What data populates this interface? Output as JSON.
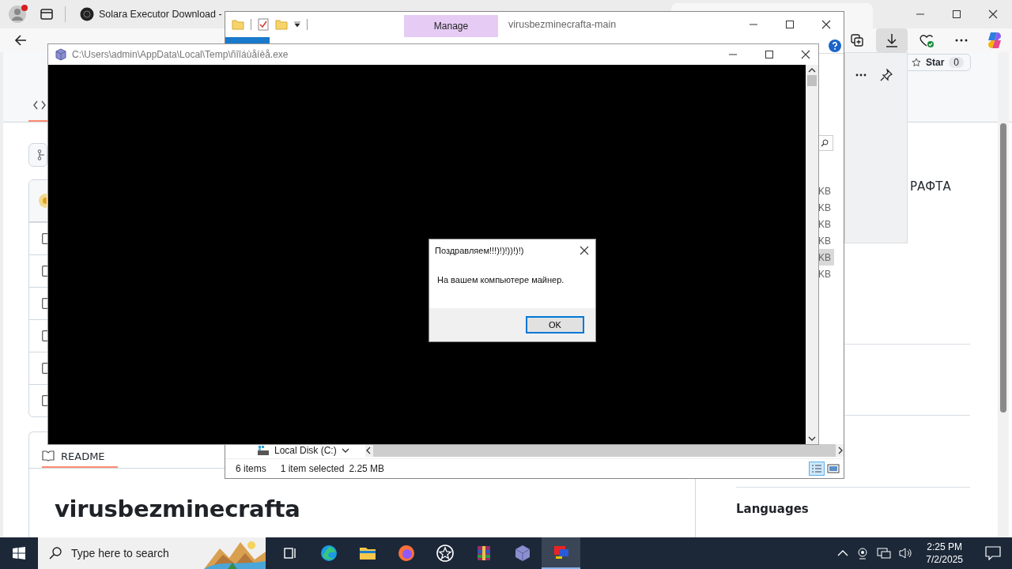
{
  "browser": {
    "tabs": [
      {
        "label": "Solara Executor Download -",
        "selected": false
      }
    ],
    "page": {
      "star_label": "Star",
      "star_count": "0",
      "readme_tab": "README",
      "repo_heading": "virusbezminecrafta",
      "description_fragment": "РАФТА",
      "languages_heading": "Languages"
    }
  },
  "explorer": {
    "title": "virusbezminecrafta-main",
    "ribbon_tab": "Manage",
    "size_column": [
      {
        "text": "KB",
        "selected": false
      },
      {
        "text": "KB",
        "selected": false
      },
      {
        "text": "KB",
        "selected": false
      },
      {
        "text": "KB",
        "selected": false
      },
      {
        "text": "KB",
        "selected": true
      },
      {
        "text": "KB",
        "selected": false
      }
    ],
    "nav_item": "Local Disk (C:)",
    "status": {
      "item_count": "6 items",
      "selection": "1 item selected",
      "selection_size": "2.25 MB"
    }
  },
  "console": {
    "title": "C:\\Users\\admin\\AppData\\Local\\Temp\\ñîîáùåíèå.exe"
  },
  "message_box": {
    "title": "Поздравляем!!!)!)!))!)!)",
    "message": "На вашем компьютере майнер.",
    "button": "OK"
  },
  "taskbar": {
    "search_placeholder": "Type here to search",
    "time": "2:25 PM",
    "date": "7/2/2025"
  }
}
